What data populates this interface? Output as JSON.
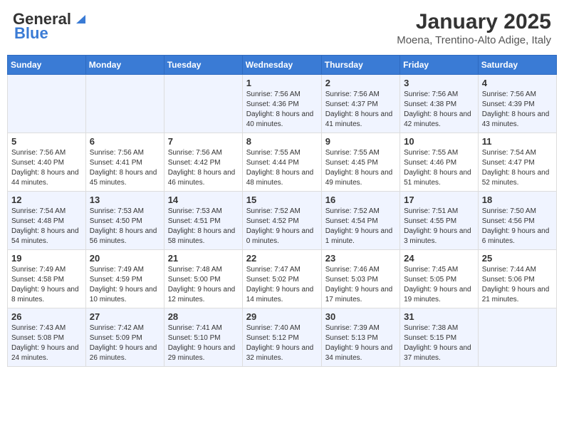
{
  "header": {
    "logo_general": "General",
    "logo_blue": "Blue",
    "month": "January 2025",
    "location": "Moena, Trentino-Alto Adige, Italy"
  },
  "weekdays": [
    "Sunday",
    "Monday",
    "Tuesday",
    "Wednesday",
    "Thursday",
    "Friday",
    "Saturday"
  ],
  "weeks": [
    [
      {
        "day": "",
        "info": ""
      },
      {
        "day": "",
        "info": ""
      },
      {
        "day": "",
        "info": ""
      },
      {
        "day": "1",
        "info": "Sunrise: 7:56 AM\nSunset: 4:36 PM\nDaylight: 8 hours and 40 minutes."
      },
      {
        "day": "2",
        "info": "Sunrise: 7:56 AM\nSunset: 4:37 PM\nDaylight: 8 hours and 41 minutes."
      },
      {
        "day": "3",
        "info": "Sunrise: 7:56 AM\nSunset: 4:38 PM\nDaylight: 8 hours and 42 minutes."
      },
      {
        "day": "4",
        "info": "Sunrise: 7:56 AM\nSunset: 4:39 PM\nDaylight: 8 hours and 43 minutes."
      }
    ],
    [
      {
        "day": "5",
        "info": "Sunrise: 7:56 AM\nSunset: 4:40 PM\nDaylight: 8 hours and 44 minutes."
      },
      {
        "day": "6",
        "info": "Sunrise: 7:56 AM\nSunset: 4:41 PM\nDaylight: 8 hours and 45 minutes."
      },
      {
        "day": "7",
        "info": "Sunrise: 7:56 AM\nSunset: 4:42 PM\nDaylight: 8 hours and 46 minutes."
      },
      {
        "day": "8",
        "info": "Sunrise: 7:55 AM\nSunset: 4:44 PM\nDaylight: 8 hours and 48 minutes."
      },
      {
        "day": "9",
        "info": "Sunrise: 7:55 AM\nSunset: 4:45 PM\nDaylight: 8 hours and 49 minutes."
      },
      {
        "day": "10",
        "info": "Sunrise: 7:55 AM\nSunset: 4:46 PM\nDaylight: 8 hours and 51 minutes."
      },
      {
        "day": "11",
        "info": "Sunrise: 7:54 AM\nSunset: 4:47 PM\nDaylight: 8 hours and 52 minutes."
      }
    ],
    [
      {
        "day": "12",
        "info": "Sunrise: 7:54 AM\nSunset: 4:48 PM\nDaylight: 8 hours and 54 minutes."
      },
      {
        "day": "13",
        "info": "Sunrise: 7:53 AM\nSunset: 4:50 PM\nDaylight: 8 hours and 56 minutes."
      },
      {
        "day": "14",
        "info": "Sunrise: 7:53 AM\nSunset: 4:51 PM\nDaylight: 8 hours and 58 minutes."
      },
      {
        "day": "15",
        "info": "Sunrise: 7:52 AM\nSunset: 4:52 PM\nDaylight: 9 hours and 0 minutes."
      },
      {
        "day": "16",
        "info": "Sunrise: 7:52 AM\nSunset: 4:54 PM\nDaylight: 9 hours and 1 minute."
      },
      {
        "day": "17",
        "info": "Sunrise: 7:51 AM\nSunset: 4:55 PM\nDaylight: 9 hours and 3 minutes."
      },
      {
        "day": "18",
        "info": "Sunrise: 7:50 AM\nSunset: 4:56 PM\nDaylight: 9 hours and 6 minutes."
      }
    ],
    [
      {
        "day": "19",
        "info": "Sunrise: 7:49 AM\nSunset: 4:58 PM\nDaylight: 9 hours and 8 minutes."
      },
      {
        "day": "20",
        "info": "Sunrise: 7:49 AM\nSunset: 4:59 PM\nDaylight: 9 hours and 10 minutes."
      },
      {
        "day": "21",
        "info": "Sunrise: 7:48 AM\nSunset: 5:00 PM\nDaylight: 9 hours and 12 minutes."
      },
      {
        "day": "22",
        "info": "Sunrise: 7:47 AM\nSunset: 5:02 PM\nDaylight: 9 hours and 14 minutes."
      },
      {
        "day": "23",
        "info": "Sunrise: 7:46 AM\nSunset: 5:03 PM\nDaylight: 9 hours and 17 minutes."
      },
      {
        "day": "24",
        "info": "Sunrise: 7:45 AM\nSunset: 5:05 PM\nDaylight: 9 hours and 19 minutes."
      },
      {
        "day": "25",
        "info": "Sunrise: 7:44 AM\nSunset: 5:06 PM\nDaylight: 9 hours and 21 minutes."
      }
    ],
    [
      {
        "day": "26",
        "info": "Sunrise: 7:43 AM\nSunset: 5:08 PM\nDaylight: 9 hours and 24 minutes."
      },
      {
        "day": "27",
        "info": "Sunrise: 7:42 AM\nSunset: 5:09 PM\nDaylight: 9 hours and 26 minutes."
      },
      {
        "day": "28",
        "info": "Sunrise: 7:41 AM\nSunset: 5:10 PM\nDaylight: 9 hours and 29 minutes."
      },
      {
        "day": "29",
        "info": "Sunrise: 7:40 AM\nSunset: 5:12 PM\nDaylight: 9 hours and 32 minutes."
      },
      {
        "day": "30",
        "info": "Sunrise: 7:39 AM\nSunset: 5:13 PM\nDaylight: 9 hours and 34 minutes."
      },
      {
        "day": "31",
        "info": "Sunrise: 7:38 AM\nSunset: 5:15 PM\nDaylight: 9 hours and 37 minutes."
      },
      {
        "day": "",
        "info": ""
      }
    ]
  ]
}
